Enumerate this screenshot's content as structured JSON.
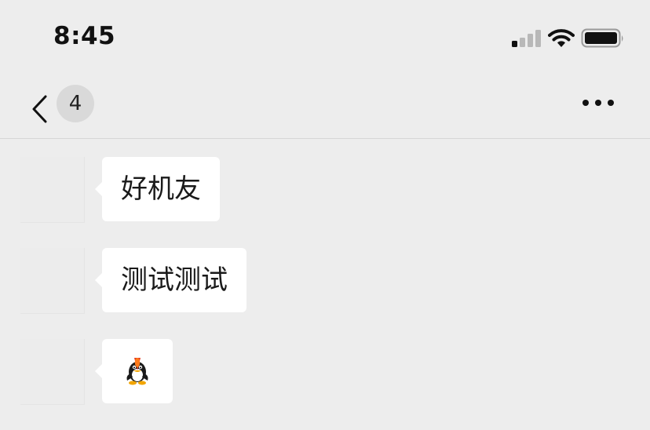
{
  "status_bar": {
    "time": "8:45",
    "signal_icon": "signal-bars-icon",
    "wifi_icon": "wifi-icon",
    "battery_icon": "battery-icon"
  },
  "nav_bar": {
    "back_icon": "chevron-left-icon",
    "unread_count": "4",
    "more_icon": "more-dots-icon"
  },
  "messages": [
    {
      "type": "text",
      "text": "好机友"
    },
    {
      "type": "text",
      "text": "测试测试"
    },
    {
      "type": "sticker",
      "sticker_icon": "qq-penguin-icon"
    }
  ],
  "colors": {
    "background": "#ededed",
    "bubble": "#ffffff",
    "badge": "#d9d9d9",
    "text": "#1a1a1a"
  }
}
